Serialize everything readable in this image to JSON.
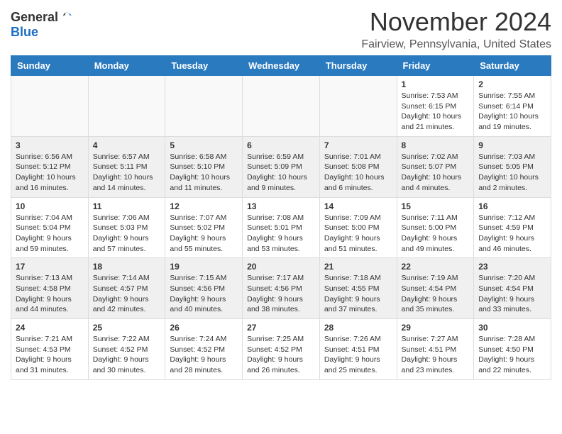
{
  "logo": {
    "general": "General",
    "blue": "Blue"
  },
  "title": "November 2024",
  "location": "Fairview, Pennsylvania, United States",
  "days_of_week": [
    "Sunday",
    "Monday",
    "Tuesday",
    "Wednesday",
    "Thursday",
    "Friday",
    "Saturday"
  ],
  "weeks": [
    [
      {
        "day": "",
        "info": ""
      },
      {
        "day": "",
        "info": ""
      },
      {
        "day": "",
        "info": ""
      },
      {
        "day": "",
        "info": ""
      },
      {
        "day": "",
        "info": ""
      },
      {
        "day": "1",
        "info": "Sunrise: 7:53 AM\nSunset: 6:15 PM\nDaylight: 10 hours and 21 minutes."
      },
      {
        "day": "2",
        "info": "Sunrise: 7:55 AM\nSunset: 6:14 PM\nDaylight: 10 hours and 19 minutes."
      }
    ],
    [
      {
        "day": "3",
        "info": "Sunrise: 6:56 AM\nSunset: 5:12 PM\nDaylight: 10 hours and 16 minutes."
      },
      {
        "day": "4",
        "info": "Sunrise: 6:57 AM\nSunset: 5:11 PM\nDaylight: 10 hours and 14 minutes."
      },
      {
        "day": "5",
        "info": "Sunrise: 6:58 AM\nSunset: 5:10 PM\nDaylight: 10 hours and 11 minutes."
      },
      {
        "day": "6",
        "info": "Sunrise: 6:59 AM\nSunset: 5:09 PM\nDaylight: 10 hours and 9 minutes."
      },
      {
        "day": "7",
        "info": "Sunrise: 7:01 AM\nSunset: 5:08 PM\nDaylight: 10 hours and 6 minutes."
      },
      {
        "day": "8",
        "info": "Sunrise: 7:02 AM\nSunset: 5:07 PM\nDaylight: 10 hours and 4 minutes."
      },
      {
        "day": "9",
        "info": "Sunrise: 7:03 AM\nSunset: 5:05 PM\nDaylight: 10 hours and 2 minutes."
      }
    ],
    [
      {
        "day": "10",
        "info": "Sunrise: 7:04 AM\nSunset: 5:04 PM\nDaylight: 9 hours and 59 minutes."
      },
      {
        "day": "11",
        "info": "Sunrise: 7:06 AM\nSunset: 5:03 PM\nDaylight: 9 hours and 57 minutes."
      },
      {
        "day": "12",
        "info": "Sunrise: 7:07 AM\nSunset: 5:02 PM\nDaylight: 9 hours and 55 minutes."
      },
      {
        "day": "13",
        "info": "Sunrise: 7:08 AM\nSunset: 5:01 PM\nDaylight: 9 hours and 53 minutes."
      },
      {
        "day": "14",
        "info": "Sunrise: 7:09 AM\nSunset: 5:00 PM\nDaylight: 9 hours and 51 minutes."
      },
      {
        "day": "15",
        "info": "Sunrise: 7:11 AM\nSunset: 5:00 PM\nDaylight: 9 hours and 49 minutes."
      },
      {
        "day": "16",
        "info": "Sunrise: 7:12 AM\nSunset: 4:59 PM\nDaylight: 9 hours and 46 minutes."
      }
    ],
    [
      {
        "day": "17",
        "info": "Sunrise: 7:13 AM\nSunset: 4:58 PM\nDaylight: 9 hours and 44 minutes."
      },
      {
        "day": "18",
        "info": "Sunrise: 7:14 AM\nSunset: 4:57 PM\nDaylight: 9 hours and 42 minutes."
      },
      {
        "day": "19",
        "info": "Sunrise: 7:15 AM\nSunset: 4:56 PM\nDaylight: 9 hours and 40 minutes."
      },
      {
        "day": "20",
        "info": "Sunrise: 7:17 AM\nSunset: 4:56 PM\nDaylight: 9 hours and 38 minutes."
      },
      {
        "day": "21",
        "info": "Sunrise: 7:18 AM\nSunset: 4:55 PM\nDaylight: 9 hours and 37 minutes."
      },
      {
        "day": "22",
        "info": "Sunrise: 7:19 AM\nSunset: 4:54 PM\nDaylight: 9 hours and 35 minutes."
      },
      {
        "day": "23",
        "info": "Sunrise: 7:20 AM\nSunset: 4:54 PM\nDaylight: 9 hours and 33 minutes."
      }
    ],
    [
      {
        "day": "24",
        "info": "Sunrise: 7:21 AM\nSunset: 4:53 PM\nDaylight: 9 hours and 31 minutes."
      },
      {
        "day": "25",
        "info": "Sunrise: 7:22 AM\nSunset: 4:52 PM\nDaylight: 9 hours and 30 minutes."
      },
      {
        "day": "26",
        "info": "Sunrise: 7:24 AM\nSunset: 4:52 PM\nDaylight: 9 hours and 28 minutes."
      },
      {
        "day": "27",
        "info": "Sunrise: 7:25 AM\nSunset: 4:52 PM\nDaylight: 9 hours and 26 minutes."
      },
      {
        "day": "28",
        "info": "Sunrise: 7:26 AM\nSunset: 4:51 PM\nDaylight: 9 hours and 25 minutes."
      },
      {
        "day": "29",
        "info": "Sunrise: 7:27 AM\nSunset: 4:51 PM\nDaylight: 9 hours and 23 minutes."
      },
      {
        "day": "30",
        "info": "Sunrise: 7:28 AM\nSunset: 4:50 PM\nDaylight: 9 hours and 22 minutes."
      }
    ]
  ]
}
